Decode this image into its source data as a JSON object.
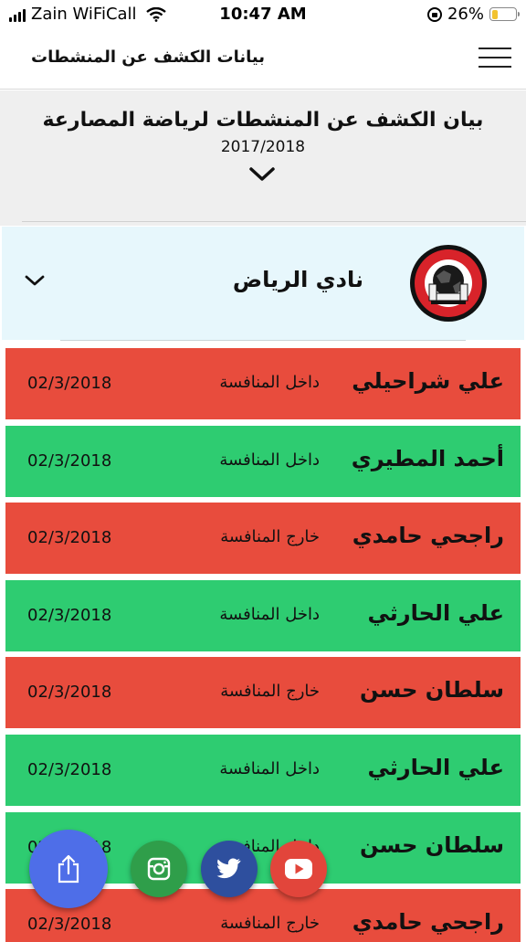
{
  "status_bar": {
    "carrier": "Zain WiFiCall",
    "time": "10:47 AM",
    "battery": "26%",
    "battery_level": 0.26
  },
  "nav": {
    "title": "بيانات الكشف عن المنشطات"
  },
  "report": {
    "title": "بيان الكشف عن المنشطات لرياضة المصارعة",
    "year": "2017/2018"
  },
  "club": {
    "name": "نادي الرياض"
  },
  "rows": [
    {
      "name": "علي شراحيلي",
      "status": "داخل المنافسة",
      "date": "02/3/2018",
      "color": "#e84c3d"
    },
    {
      "name": "أحمد المطيري",
      "status": "داخل المنافسة",
      "date": "02/3/2018",
      "color": "#2ecc71"
    },
    {
      "name": "راجحي حامدي",
      "status": "خارج المنافسة",
      "date": "02/3/2018",
      "color": "#e84c3d"
    },
    {
      "name": "علي الحارثي",
      "status": "داخل المنافسة",
      "date": "02/3/2018",
      "color": "#2ecc71"
    },
    {
      "name": "سلطان حسن",
      "status": "خارج المنافسة",
      "date": "02/3/2018",
      "color": "#e84c3d"
    },
    {
      "name": "علي الحارثي",
      "status": "داخل المنافسة",
      "date": "02/3/2018",
      "color": "#2ecc71"
    },
    {
      "name": "سلطان حسن",
      "status": "داخل المنافسة",
      "date": "02/3/2018",
      "color": "#2ecc71"
    },
    {
      "name": "راجحي حامدي",
      "status": "خارج المنافسة",
      "date": "02/3/2018",
      "color": "#e84c3d"
    }
  ],
  "floating_buttons": [
    {
      "icon": "share-icon",
      "color": "#4e6ee8"
    },
    {
      "icon": "instagram-icon",
      "color": "#2f9e4a"
    },
    {
      "icon": "twitter-icon",
      "color": "#2e4f9e"
    },
    {
      "icon": "youtube-icon",
      "color": "#e2453b"
    }
  ]
}
